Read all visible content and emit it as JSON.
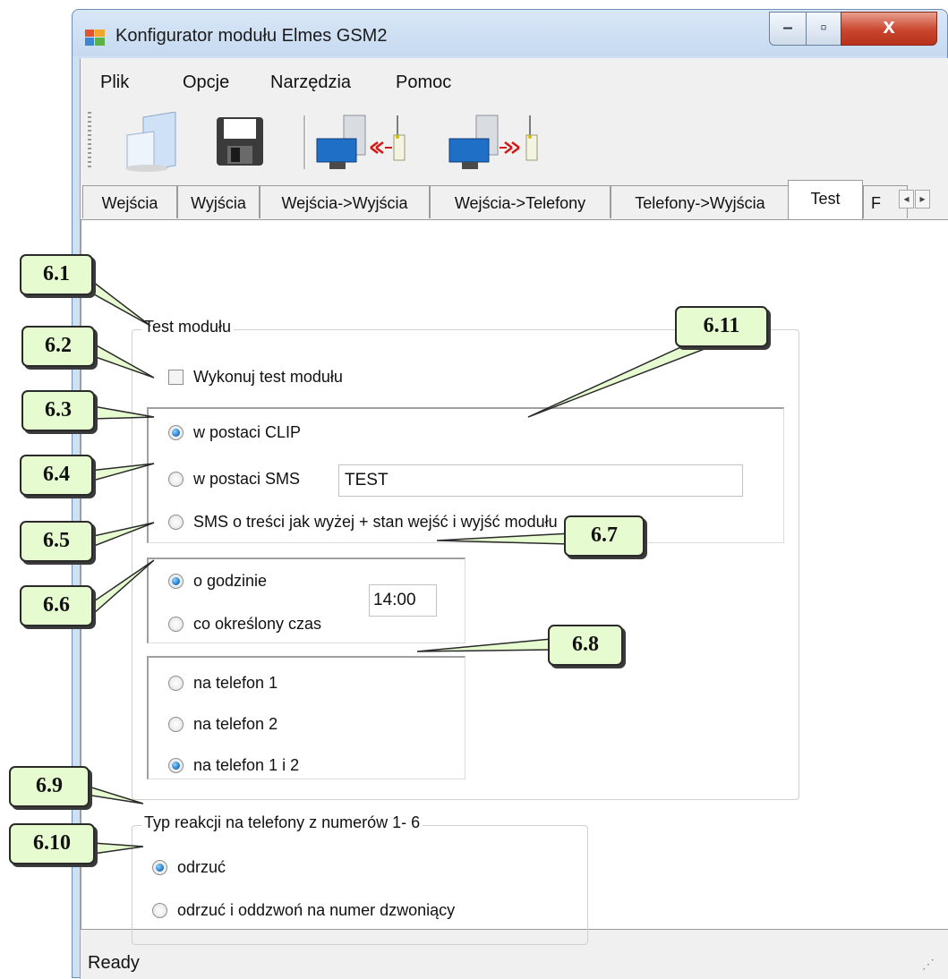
{
  "window": {
    "title": "Konfigurator modułu Elmes GSM2"
  },
  "menu": [
    "Plik",
    "Opcje",
    "Narzędzia",
    "Pomoc"
  ],
  "tabs": [
    "Wejścia",
    "Wyjścia",
    "Wejścia->Wyjścia",
    "Wejścia->Telefony",
    "Telefony->Wyjścia",
    "Test",
    "F"
  ],
  "test_group": {
    "legend": "Test modułu",
    "checkbox_label": "Wykonuj test modułu",
    "mode_options": [
      "w postaci CLIP",
      "w postaci SMS",
      "SMS o treści jak wyżej + stan wejść i wyjść modułu"
    ],
    "sms_text": "TEST",
    "time_options": [
      "o godzinie",
      "co określony czas"
    ],
    "time_value": "14:00",
    "phone_options": [
      "na telefon 1",
      "na telefon 2",
      "na telefon 1 i 2"
    ]
  },
  "reaction_group": {
    "legend": "Typ reakcji na telefony z numerów 1- 6",
    "options": [
      "odrzuć",
      "odrzuć i oddzwoń na numer dzwoniący"
    ]
  },
  "status": "Ready",
  "callouts": [
    "6.1",
    "6.2",
    "6.3",
    "6.4",
    "6.5",
    "6.6",
    "6.7",
    "6.8",
    "6.9",
    "6.10",
    "6.11"
  ]
}
